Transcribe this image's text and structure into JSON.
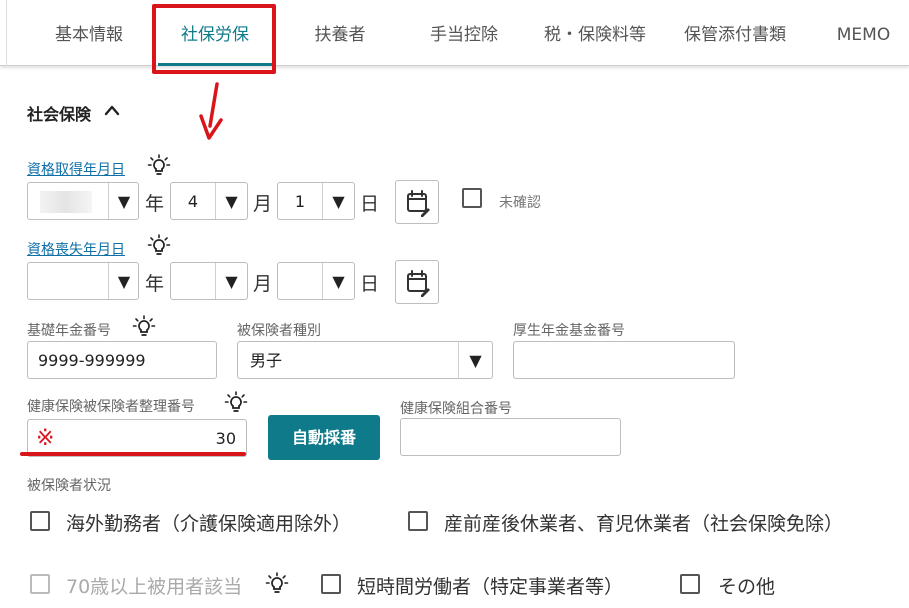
{
  "tabs": [
    {
      "label": "基本情報"
    },
    {
      "label": "社保労保"
    },
    {
      "label": "扶養者"
    },
    {
      "label": "手当控除"
    },
    {
      "label": "税・保険料等"
    },
    {
      "label": "保管添付書類"
    },
    {
      "label": "MEMO"
    }
  ],
  "active_tab": "社保労保",
  "section": {
    "title": "社会保険",
    "toggle_icon": "chevron-up-icon"
  },
  "acquisition_date": {
    "label": "資格取得年月日",
    "year": "",
    "month": "4",
    "day": "1",
    "year_unit": "年",
    "month_unit": "月",
    "day_unit": "日",
    "unconfirmed_label": "未確認",
    "unconfirmed_checked": false
  },
  "loss_date": {
    "label": "資格喪失年月日",
    "year": "",
    "month": "",
    "day": "",
    "year_unit": "年",
    "month_unit": "月",
    "day_unit": "日"
  },
  "basic_pension_number": {
    "label": "基礎年金番号",
    "value": "9999-999999"
  },
  "insured_type": {
    "label": "被保険者種別",
    "value": "男子"
  },
  "pension_fund_number": {
    "label": "厚生年金基金番号",
    "value": ""
  },
  "health_insured_number": {
    "label": "健康保険被保険者整理番号",
    "value": "30",
    "mark": "※"
  },
  "auto_number_button": {
    "label": "自動採番"
  },
  "health_union_number": {
    "label": "健康保険組合番号",
    "value": ""
  },
  "insured_status": {
    "label": "被保険者状況",
    "options": [
      {
        "label": "海外勤務者（介護保険適用除外）",
        "checked": false,
        "disabled": false
      },
      {
        "label": "産前産後休業者、育児休業者（社会保険免除）",
        "checked": false,
        "disabled": false
      },
      {
        "label": "70歳以上被用者該当",
        "checked": false,
        "disabled": true
      },
      {
        "label": "短時間労働者（特定事業者等）",
        "checked": false,
        "disabled": false
      },
      {
        "label": "その他",
        "checked": false,
        "disabled": false
      }
    ]
  },
  "colors": {
    "accent": "#0f7b8a",
    "link": "#0f6fa6",
    "highlight": "#d9141b"
  }
}
